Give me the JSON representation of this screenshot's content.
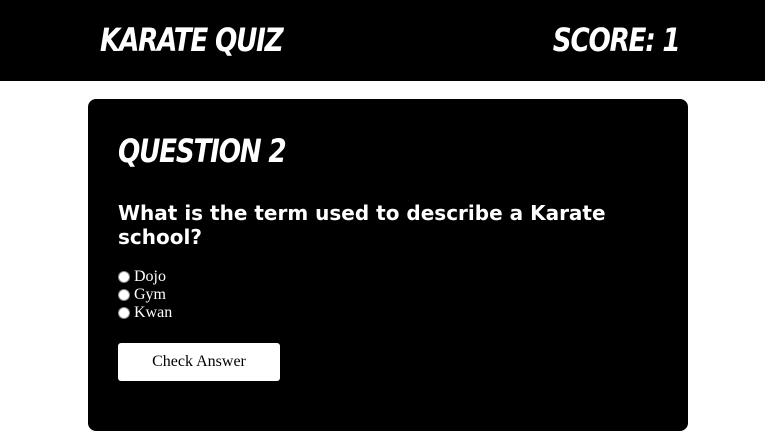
{
  "header": {
    "title": "KARATE QUIZ",
    "score_text": "SCORE: 1"
  },
  "quiz": {
    "question_number": "QUESTION 2",
    "question_text": "What is the term used to describe a Karate school?",
    "options": [
      {
        "label": "Dojo",
        "selected": false
      },
      {
        "label": "Gym",
        "selected": false
      },
      {
        "label": "Kwan",
        "selected": false
      }
    ],
    "check_button_label": "Check Answer"
  },
  "colors": {
    "header_background": "#000000",
    "card_background": "#000000",
    "page_background": "#ffffff",
    "text_on_dark": "#ffffff",
    "button_background": "#ffffff"
  }
}
